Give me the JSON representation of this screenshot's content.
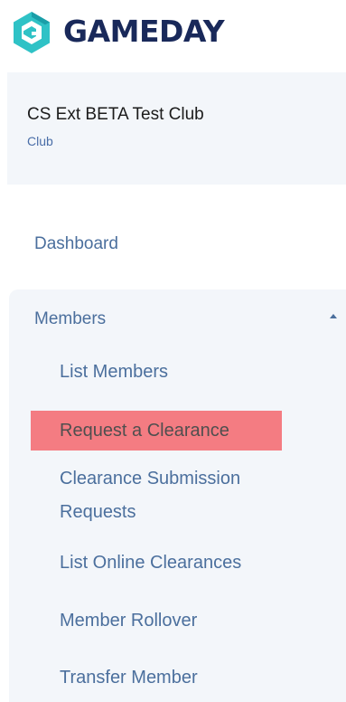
{
  "header": {
    "logo_text": "GAMEDAY",
    "logo_colors": {
      "mark_primary": "#2fc2c6",
      "mark_secondary": "#1a9ea8",
      "text": "#19295a"
    }
  },
  "org": {
    "name": "CS Ext BETA Test Club",
    "type": "Club"
  },
  "nav": {
    "dashboard_label": "Dashboard",
    "members": {
      "label": "Members",
      "expanded": true,
      "items": [
        {
          "label": "List Members"
        },
        {
          "label": "Request a Clearance",
          "highlighted": true
        },
        {
          "label": "Clearance Submission Requests"
        },
        {
          "label": "List Online Clearances"
        },
        {
          "label": "Member Rollover"
        },
        {
          "label": "Transfer Member"
        }
      ]
    }
  },
  "colors": {
    "nav_text": "#4b6f9d",
    "section_bg": "#f3f6fa",
    "highlight": "#f47c82"
  }
}
